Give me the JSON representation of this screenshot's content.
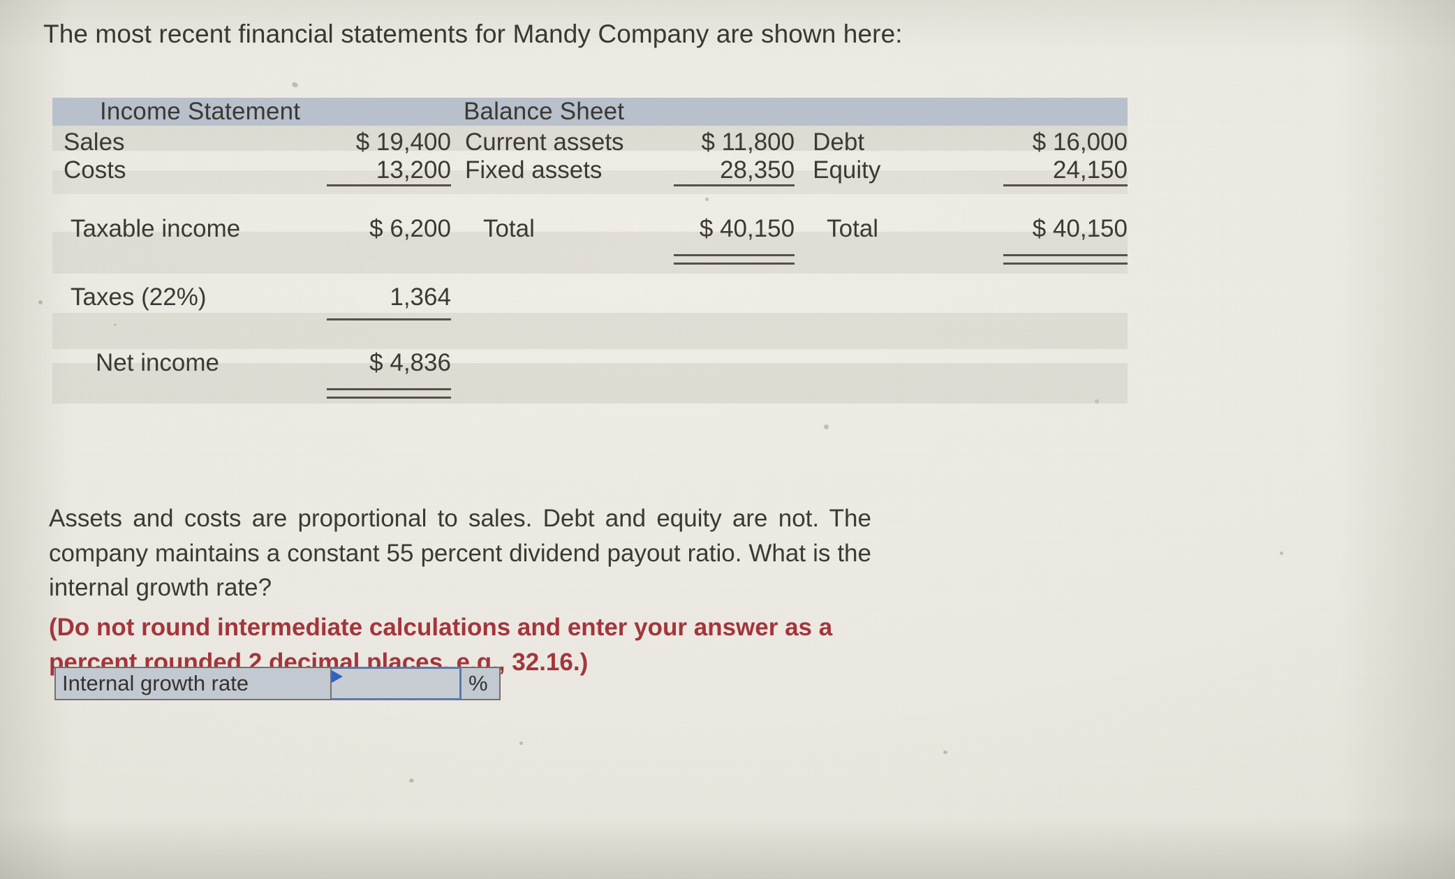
{
  "intro": "The most recent financial statements for Mandy Company are shown here:",
  "statements": {
    "income_statement": {
      "title": "Income Statement",
      "rows": [
        {
          "label": "Sales",
          "value": "$ 19,400"
        },
        {
          "label": "Costs",
          "value": "13,200"
        },
        {
          "label": "Taxable income",
          "value": "$ 6,200"
        },
        {
          "label": "Taxes (22%)",
          "value": "1,364"
        },
        {
          "label": "Net income",
          "value": "$ 4,836"
        }
      ]
    },
    "balance_sheet": {
      "title": "Balance Sheet",
      "assets": [
        {
          "label": "Current assets",
          "value": "$ 11,800"
        },
        {
          "label": "Fixed assets",
          "value": "28,350"
        },
        {
          "label": "Total",
          "value": "$ 40,150"
        }
      ],
      "liabilities_equity": [
        {
          "label": "Debt",
          "value": "$ 16,000"
        },
        {
          "label": "Equity",
          "value": "24,150"
        },
        {
          "label": "Total",
          "value": "$ 40,150"
        }
      ]
    }
  },
  "question": {
    "body": "Assets and costs are proportional to sales. Debt and equity are not. The company maintains a constant 55 percent dividend payout ratio. What is the internal growth rate?",
    "emphasis": "(Do not round intermediate calculations and enter your answer as a percent rounded 2 decimal places, e.g., 32.16.)"
  },
  "answer": {
    "label": "Internal growth rate",
    "value": "",
    "placeholder": "",
    "unit": "%"
  },
  "colors": {
    "header_band": "#b7c0cb",
    "emphasis_red": "#a3353c",
    "input_border_focus": "#5c78a8",
    "caret_blue": "#2f62c4",
    "paper": "#ece9e1",
    "text": "#3c3934"
  }
}
